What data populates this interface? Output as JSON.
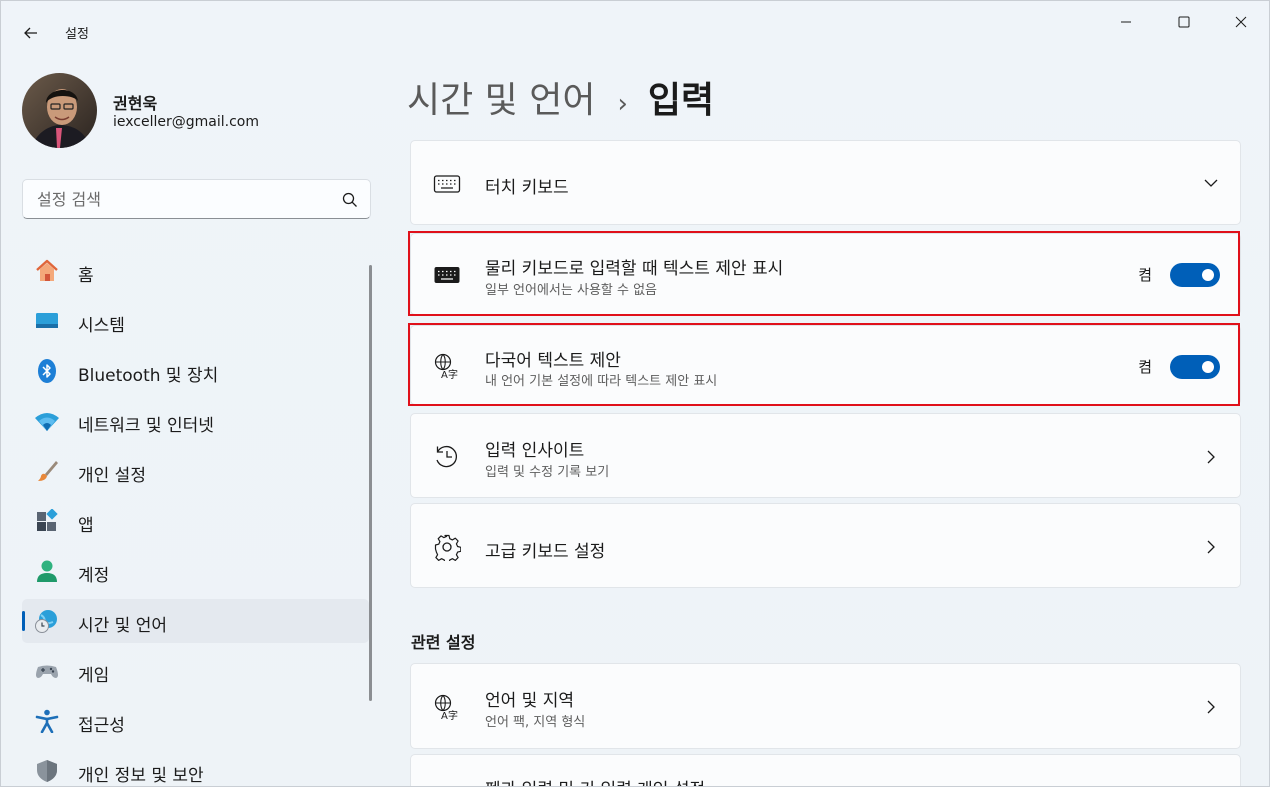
{
  "window": {
    "app_title": "설정"
  },
  "profile": {
    "name": "권현욱",
    "email": "iexceller@gmail.com"
  },
  "search": {
    "placeholder": "설정 검색"
  },
  "nav": {
    "items": [
      {
        "label": "홈",
        "icon": "home-icon"
      },
      {
        "label": "시스템",
        "icon": "system-icon"
      },
      {
        "label": "Bluetooth 및 장치",
        "icon": "bluetooth-icon"
      },
      {
        "label": "네트워크 및 인터넷",
        "icon": "wifi-icon"
      },
      {
        "label": "개인 설정",
        "icon": "brush-icon"
      },
      {
        "label": "앱",
        "icon": "apps-icon"
      },
      {
        "label": "계정",
        "icon": "account-icon"
      },
      {
        "label": "시간 및 언어",
        "icon": "time-language-icon",
        "active": true
      },
      {
        "label": "게임",
        "icon": "gamepad-icon"
      },
      {
        "label": "접근성",
        "icon": "accessibility-icon"
      },
      {
        "label": "개인 정보 및 보안",
        "icon": "shield-icon"
      }
    ]
  },
  "breadcrumb": {
    "parent": "시간 및 언어",
    "separator": "›",
    "current": "입력"
  },
  "cards": {
    "touch_keyboard": {
      "title": "터치 키보드",
      "icon": "keyboard-icon"
    },
    "physical_suggestions": {
      "title": "물리 키보드로 입력할 때 텍스트 제안 표시",
      "subtitle": "일부 언어에서는 사용할 수 없음",
      "state": "켬",
      "on": true,
      "icon": "keyboard-filled-icon"
    },
    "multilingual": {
      "title": "다국어 텍스트 제안",
      "subtitle": "내 언어 기본 설정에 따라 텍스트 제안 표시",
      "state": "켬",
      "on": true,
      "icon": "translate-icon"
    },
    "typing_insights": {
      "title": "입력 인사이트",
      "subtitle": "입력 및 수정 기록 보기",
      "icon": "history-icon"
    },
    "advanced_keyboard": {
      "title": "고급 키보드 설정",
      "icon": "gear-icon"
    }
  },
  "related": {
    "title": "관련 설정",
    "language_region": {
      "title": "언어 및 지역",
      "subtitle": "언어 팩, 지역 형식",
      "icon": "translate-icon"
    },
    "pen_touch": {
      "title": "펜과 입력 및 키 입력 개인 설정"
    }
  },
  "colors": {
    "accent": "#005fb8",
    "highlight": "#e0101a"
  }
}
